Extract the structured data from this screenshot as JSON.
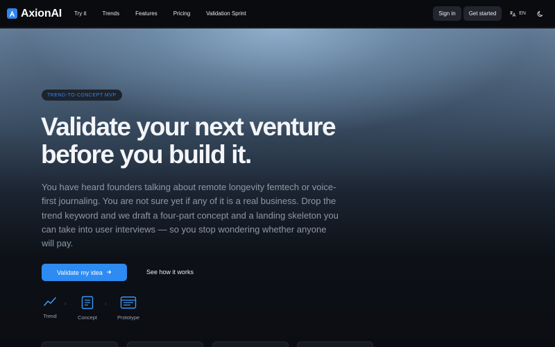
{
  "nav": {
    "brand": "AxionAI",
    "links": [
      "Try it",
      "Trends",
      "Features",
      "Pricing",
      "Validation Sprint"
    ],
    "sign_in": "Sign in",
    "get_started": "Get started",
    "lang": "EN"
  },
  "hero": {
    "badge": "TREND-TO-CONCEPT MVP",
    "headline_line1": "Validate your next venture",
    "headline_line2": "before you build it.",
    "sub": "You have heard founders talking about remote longevity femtech or voice-first journaling. You are not sure yet if any of it is a real business. Drop the trend keyword and we draft a four-part concept and a landing skeleton you can take into user interviews — so you stop wondering whether anyone will pay.",
    "cta": "Validate my idea",
    "secondary": "See how it works",
    "steps": [
      {
        "label": "Trend",
        "icon": "trend-line-icon"
      },
      {
        "label": "Concept",
        "icon": "document-icon"
      },
      {
        "label": "Prototype",
        "icon": "browser-window-icon"
      }
    ]
  },
  "colors": {
    "accent": "#2d8bf2",
    "nav_bg": "#0a0b0f",
    "text_muted": "#8f98a6"
  }
}
